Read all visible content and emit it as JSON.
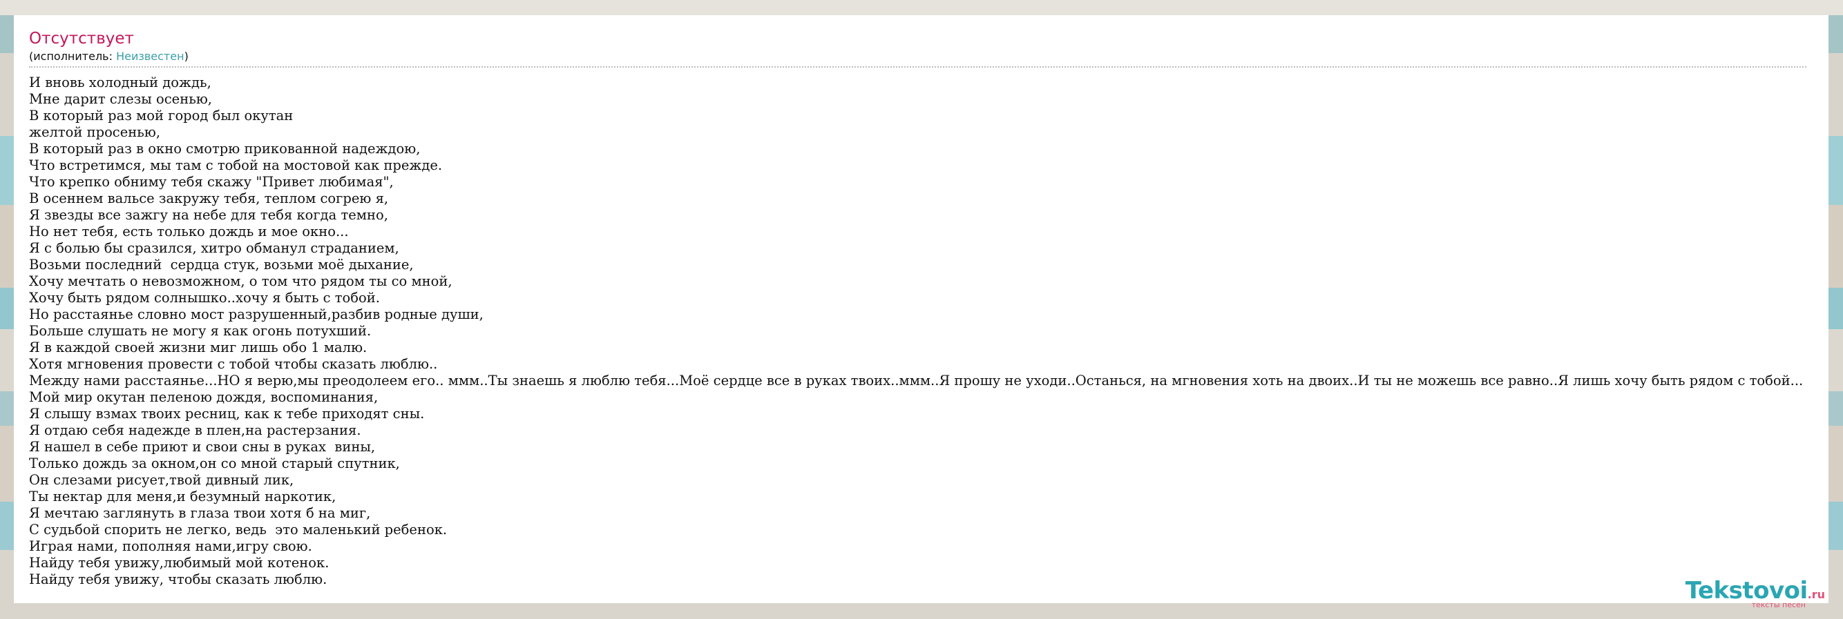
{
  "song": {
    "title": "Отсутствует",
    "performer_prefix": "(исполнитель: ",
    "performer_name": "Неизвестен",
    "performer_suffix": ")"
  },
  "lyrics": [
    "И вновь холодный дождь,",
    "Мне дарит слезы осенью,",
    "В который раз мой город был окутан",
    "желтой просенью,",
    "В который раз в окно смотрю прикованной надеждою,",
    "Что встретимся, мы там с тобой на мостовой как прежде.",
    "Что крепко обниму тебя скажу \"Привет любимая\",",
    "В осеннем вальсе закружу тебя, теплом согрею я,",
    "Я звезды все зажгу на небе для тебя когда темно,",
    "Но нет тебя, есть только дождь и мое окно...",
    "Я с болью бы сразился, хитро обманул страданием,",
    "Возьми последний  сердца стук, возьми моё дыхание,",
    "Хочу мечтать о невозможном, о том что рядом ты со мной,",
    "Хочу быть рядом солнышко..хочу я быть с тобой.",
    "Но расстаянье словно мост разрушенный,разбив родные души,",
    "Больше слушать не могу я как огонь потухший.",
    "Я в каждой своей жизни миг лишь обо 1 малю.",
    "Хотя мгновения провести с тобой чтобы сказать люблю..",
    "Между нами расстаянье...НО я верю,мы преодолеем его.. ммм..Ты знаешь я люблю тебя...Моё сердце все в руках твоих..ммм..Я прошу не уходи..Останься, на мгновения хоть на двоих..И ты не можешь все равно..Я лишь хочу быть рядом с тобой...",
    "Мой мир окутан пеленою дождя, воспоминания,",
    "Я слышу взмах твоих ресниц, как к тебе приходят сны.",
    "Я отдаю себя надежде в плен,на растерзания.",
    "Я нашел в себе приют и свои сны в руках  вины,",
    "Только дождь за окном,он со мной старый спутник,",
    "Он слезами рисует,твой дивный лик,",
    "Ты нектар для меня,и безумный наркотик,",
    "Я мечтаю заглянуть в глаза твои хотя б на миг,",
    "С судьбой спорить не легко, ведь  это маленький ребенок.",
    "Играя нами, пополняя нами,игру свою.",
    "Найду тебя увижу,любимый мой котенок.",
    "Найду тебя увижу, чтобы сказать люблю."
  ],
  "logo": {
    "brand": "Tekstovoi",
    "tld": ".ru",
    "tagline": "тексты песен"
  },
  "colors": {
    "title": "#c2185b",
    "link": "#3aa0a8",
    "brand": "#2aa6b2",
    "brand_accent": "#e3507a"
  }
}
